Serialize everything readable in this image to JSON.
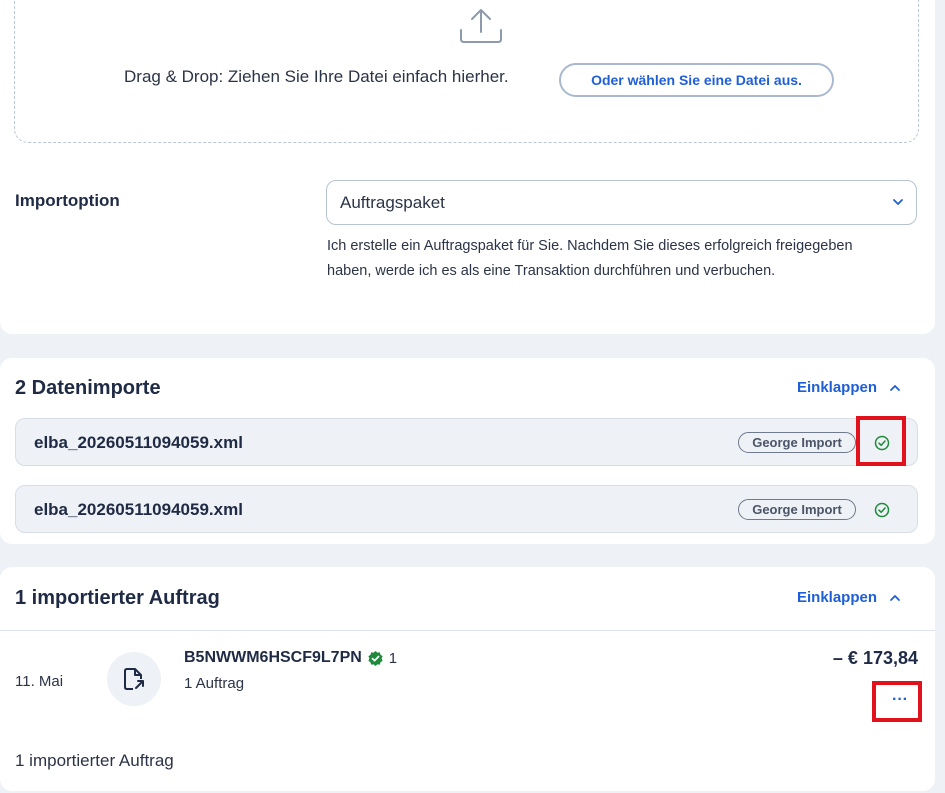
{
  "upload": {
    "dropzone_text": "Drag & Drop: Ziehen Sie Ihre Datei einfach hierher.",
    "choose_button": "Oder wählen Sie eine Datei aus.",
    "import_option_label": "Importoption",
    "import_option_value": "Auftragspaket",
    "import_option_help": "Ich erstelle ein Auftragspaket für Sie. Nachdem Sie dieses erfolgreich freigegeben haben, werde ich es als eine Transaktion durchführen und verbuchen."
  },
  "imports": {
    "title": "2 Datenimporte",
    "collapse_label": "Einklappen",
    "files": [
      {
        "name": "elba_20260511094059.xml",
        "badge": "George Import",
        "status_icon": "check-circle-icon"
      },
      {
        "name": "elba_20260511094059.xml",
        "badge": "George Import",
        "status_icon": "check-circle-icon"
      }
    ]
  },
  "orders": {
    "title": "1 importierter Auftrag",
    "collapse_label": "Einklappen",
    "items": [
      {
        "date": "11. Mai",
        "id": "B5NWWM6HSCF9L7PN",
        "verified_count": "1",
        "sub": "1 Auftrag",
        "amount": "– € 173,84",
        "more_label": "···"
      }
    ],
    "footer": "1 importierter Auftrag"
  },
  "colors": {
    "accent": "#1f5fd6",
    "success": "#1f8a3b",
    "highlight": "#e1121b",
    "background": "#eef1f5"
  }
}
